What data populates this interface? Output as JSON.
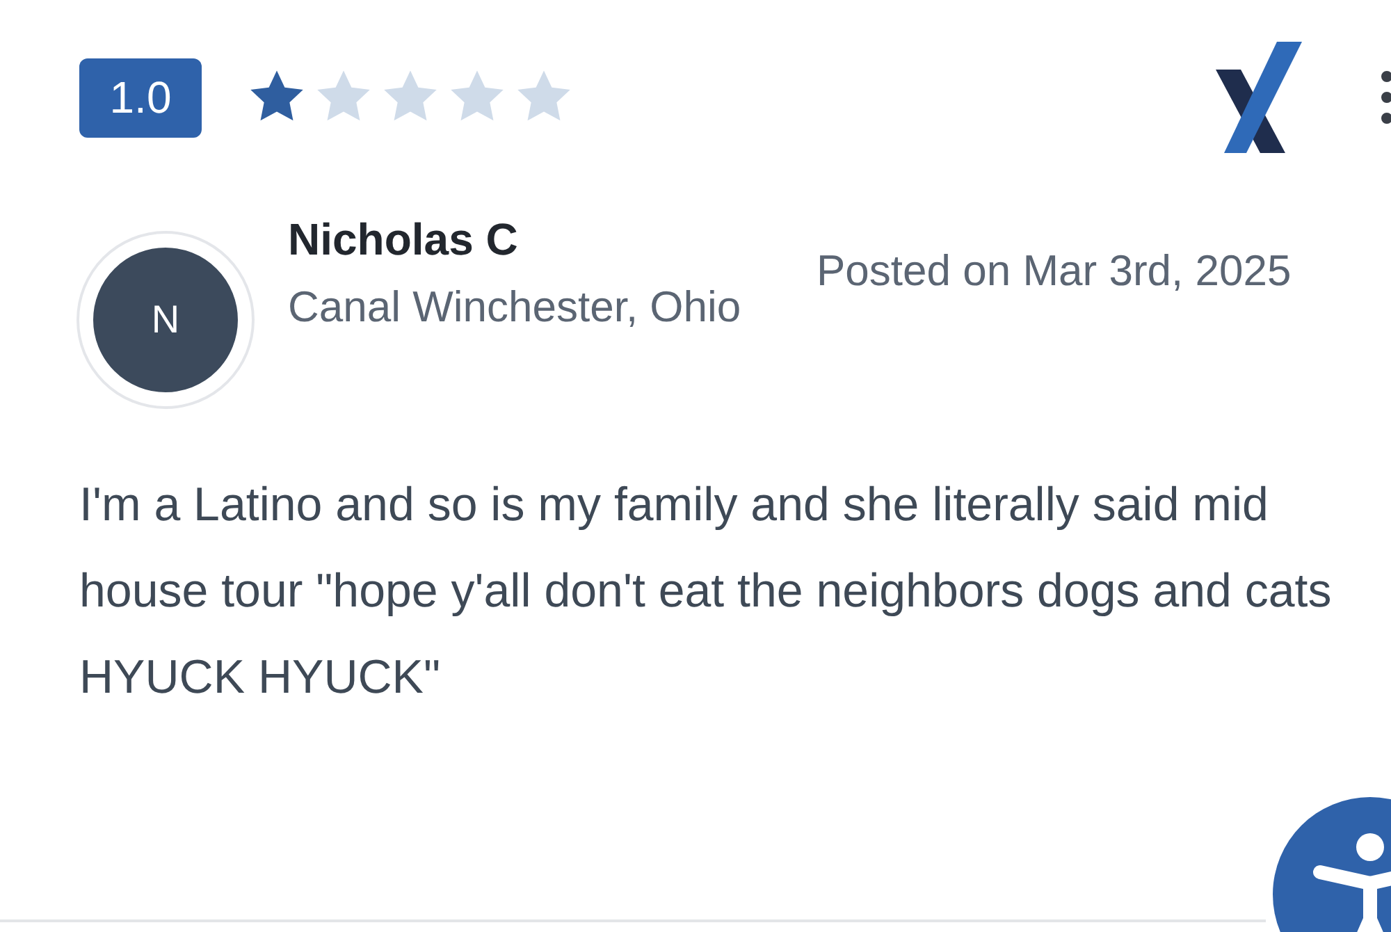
{
  "review": {
    "rating": "1.0",
    "stars": 1,
    "avatar_initial": "N",
    "author": "Nicholas C",
    "location": "Canal Winchester, Ohio",
    "posted": "Posted on Mar 3rd, 2025",
    "text": "I'm a Latino and so is my family and she literally said mid house tour \"hope y'all don't eat the neighbors dogs and cats HYUCK HYUCK\""
  }
}
